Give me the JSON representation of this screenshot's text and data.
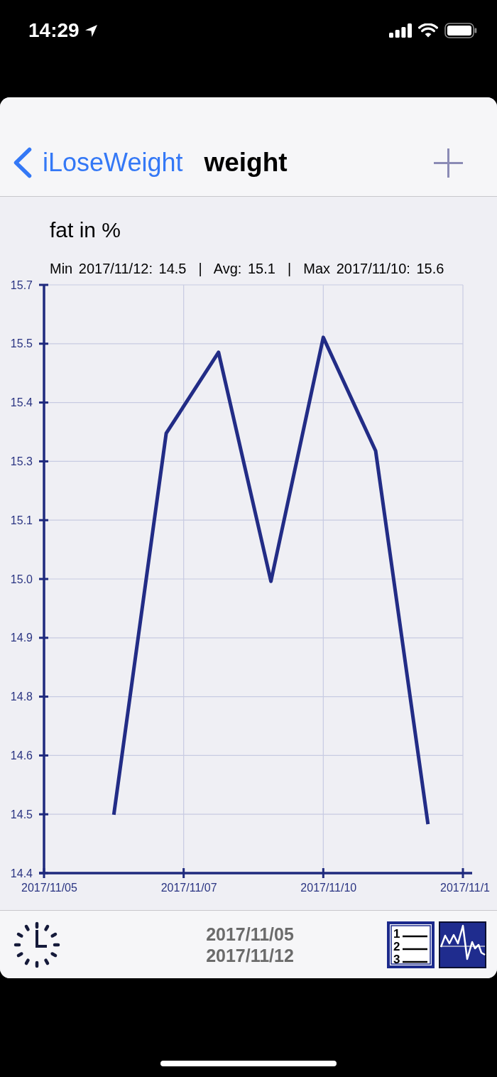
{
  "status_bar": {
    "time": "14:29"
  },
  "nav_bar": {
    "back_label": "iLoseWeight",
    "title": "weight"
  },
  "chart": {
    "stats": "Min 2017/11/12: 14.5  |  Avg: 15.1  |  Max 2017/11/10: 15.6",
    "chart_data": {
      "type": "line",
      "title": "fat in %",
      "grid": true,
      "categories": [
        "2017/11/05",
        null,
        null,
        null,
        null,
        null,
        null,
        null,
        "2017/11/07",
        null,
        null,
        null,
        null,
        null,
        null,
        null,
        "2017/11/10",
        null,
        null,
        null,
        null,
        null,
        null,
        null,
        "2017/11/1"
      ],
      "values": [
        null,
        null,
        null,
        null,
        14.497,
        null,
        null,
        15.34,
        null,
        null,
        15.519,
        null,
        null,
        15.013,
        null,
        null,
        15.552,
        null,
        null,
        15.301,
        null,
        null,
        14.476,
        null,
        null
      ],
      "ylim": [
        14.368,
        15.668
      ],
      "yticks": [
        {
          "value": 14.368,
          "label": "14.4"
        },
        {
          "value": 14.498,
          "label": "14.5"
        },
        {
          "value": 14.628,
          "label": "14.6"
        },
        {
          "value": 14.758,
          "label": "14.8"
        },
        {
          "value": 14.888,
          "label": "14.9"
        },
        {
          "value": 15.018,
          "label": "15.0"
        },
        {
          "value": 15.148,
          "label": "15.1"
        },
        {
          "value": 15.278,
          "label": "15.3"
        },
        {
          "value": 15.408,
          "label": "15.4"
        },
        {
          "value": 15.538,
          "label": "15.5"
        },
        {
          "value": 15.668,
          "label": "15.7"
        }
      ]
    }
  },
  "toolbar": {
    "date_range": [
      "2017/11/05",
      "2017/11/12"
    ],
    "list_button": {
      "numbers": [
        "1",
        "2",
        "3"
      ]
    }
  }
}
